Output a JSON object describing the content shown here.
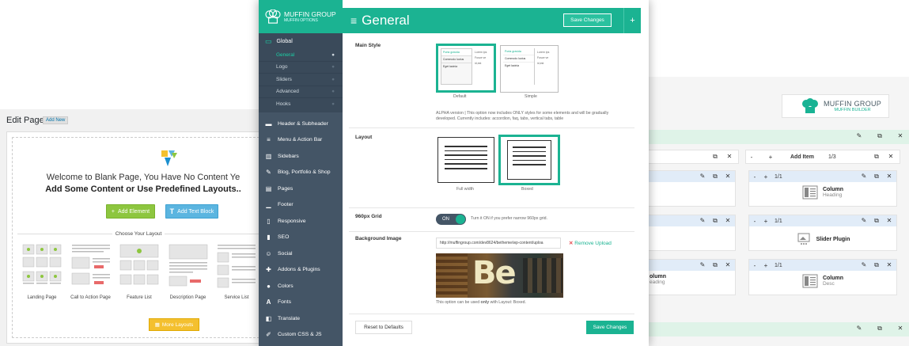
{
  "edit_page": {
    "title": "Edit Page",
    "add_new": "Add New",
    "welcome_line1": "Welcome to Blank Page, You Have No Content Ye",
    "welcome_line2": "Add Some Content or Use Predefined Layouts..",
    "add_element": "Add Element",
    "add_text_block": "Add Text Block",
    "choose_layout": "Choose Your Layout",
    "layouts": [
      "Landing Page",
      "Call to Action Page",
      "Feature List",
      "Description Page",
      "Service List"
    ],
    "more_layouts": "More Layouts",
    "colors": {
      "green": "#8dc63f",
      "blue": "#5bb5e0",
      "yellow": "#f4c02f"
    }
  },
  "builder": {
    "logo_title": "MUFFIN GROUP",
    "logo_sub": "MUFFIN BUILDER",
    "wrap_controls": {
      "minus": "-",
      "plus": "+",
      "add_item": "Add Item",
      "size": "1/3"
    },
    "item_size": "1/1",
    "items_col2": [
      {
        "title": "Column",
        "sub": "Heading"
      },
      {
        "title": "Slider Plugin",
        "sub": ""
      },
      {
        "title": "Column",
        "sub": "Desc"
      }
    ],
    "items_col1": [
      {
        "title": "olumn",
        "sub": "eading"
      }
    ]
  },
  "options": {
    "logo_title": "MUFFIN GROUP",
    "logo_sub": "MUFFIN OPTIONS",
    "page_title": "General",
    "save_changes": "Save Changes",
    "plus": "+",
    "nav": {
      "global": "Global",
      "global_sub": [
        "General",
        "Logo",
        "Sliders",
        "Advanced",
        "Hooks"
      ],
      "items": [
        "Header & Subheader",
        "Menu & Action Bar",
        "Sidebars",
        "Blog, Portfolio & Shop",
        "Pages",
        "Footer",
        "Responsive",
        "SEO",
        "Social",
        "Addons & Plugins",
        "Colors",
        "Fonts",
        "Translate",
        "Custom CSS & JS"
      ]
    },
    "main_style": {
      "label": "Main Style",
      "options": [
        "Default",
        "Simple"
      ],
      "tab_labels": [
        "Porta gravida",
        "Commodo luctus",
        "Eget lacinia"
      ],
      "lorem": [
        "Lorem ips",
        "Fusce ve",
        "id,est"
      ],
      "alpha_note": "ALPHA version | This option now includes ONLY styles for some elements and will be gradually developed. Currently includes: accordion, faq, tabs, vertical tabs, table"
    },
    "layout": {
      "label": "Layout",
      "options": [
        "Full width",
        "Boxed"
      ]
    },
    "grid": {
      "label": "960px Grid",
      "state": "ON",
      "note": "Turn it ON if you prefer narrow 960px grid."
    },
    "bg_image": {
      "label": "Background Image",
      "url": "http://muffingroup.com/dev8624/betheme/wp-content/uploa",
      "remove": "Remove Upload",
      "image_text": "Be",
      "note_pre": "This option can be used ",
      "note_bold": "only",
      "note_post": " with Layout: Boxed."
    },
    "reset": "Reset to Defaults",
    "save_bottom": "Save Changes",
    "accent": "#1bb392",
    "sidebar_color": "#445566"
  }
}
